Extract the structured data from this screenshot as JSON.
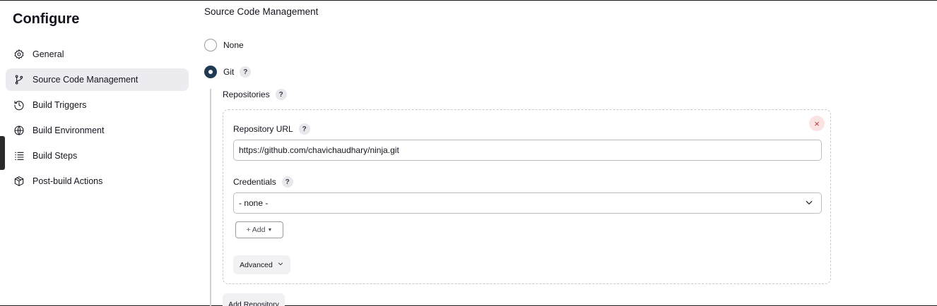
{
  "sidebar": {
    "title": "Configure",
    "items": [
      {
        "label": "General",
        "icon": "gear-icon"
      },
      {
        "label": "Source Code Management",
        "icon": "branch-icon",
        "active": true
      },
      {
        "label": "Build Triggers",
        "icon": "clock-icon"
      },
      {
        "label": "Build Environment",
        "icon": "globe-icon"
      },
      {
        "label": "Build Steps",
        "icon": "list-icon"
      },
      {
        "label": "Post-build Actions",
        "icon": "package-icon"
      }
    ]
  },
  "scm": {
    "title": "Source Code Management",
    "none_label": "None",
    "git_label": "Git",
    "selected": "Git",
    "help_glyph": "?",
    "repositories_label": "Repositories",
    "repo": {
      "url_label": "Repository URL",
      "url_value": "https://github.com/chavichaudhary/ninja.git",
      "credentials_label": "Credentials",
      "credentials_value": "- none -",
      "add_label": "Add",
      "advanced_label": "Advanced",
      "remove_glyph": "×"
    },
    "add_repository_label": "Add Repository"
  },
  "colors": {
    "accent": "#1f3a52",
    "active_bg": "#ebebf0",
    "danger": "#c43b3b"
  }
}
